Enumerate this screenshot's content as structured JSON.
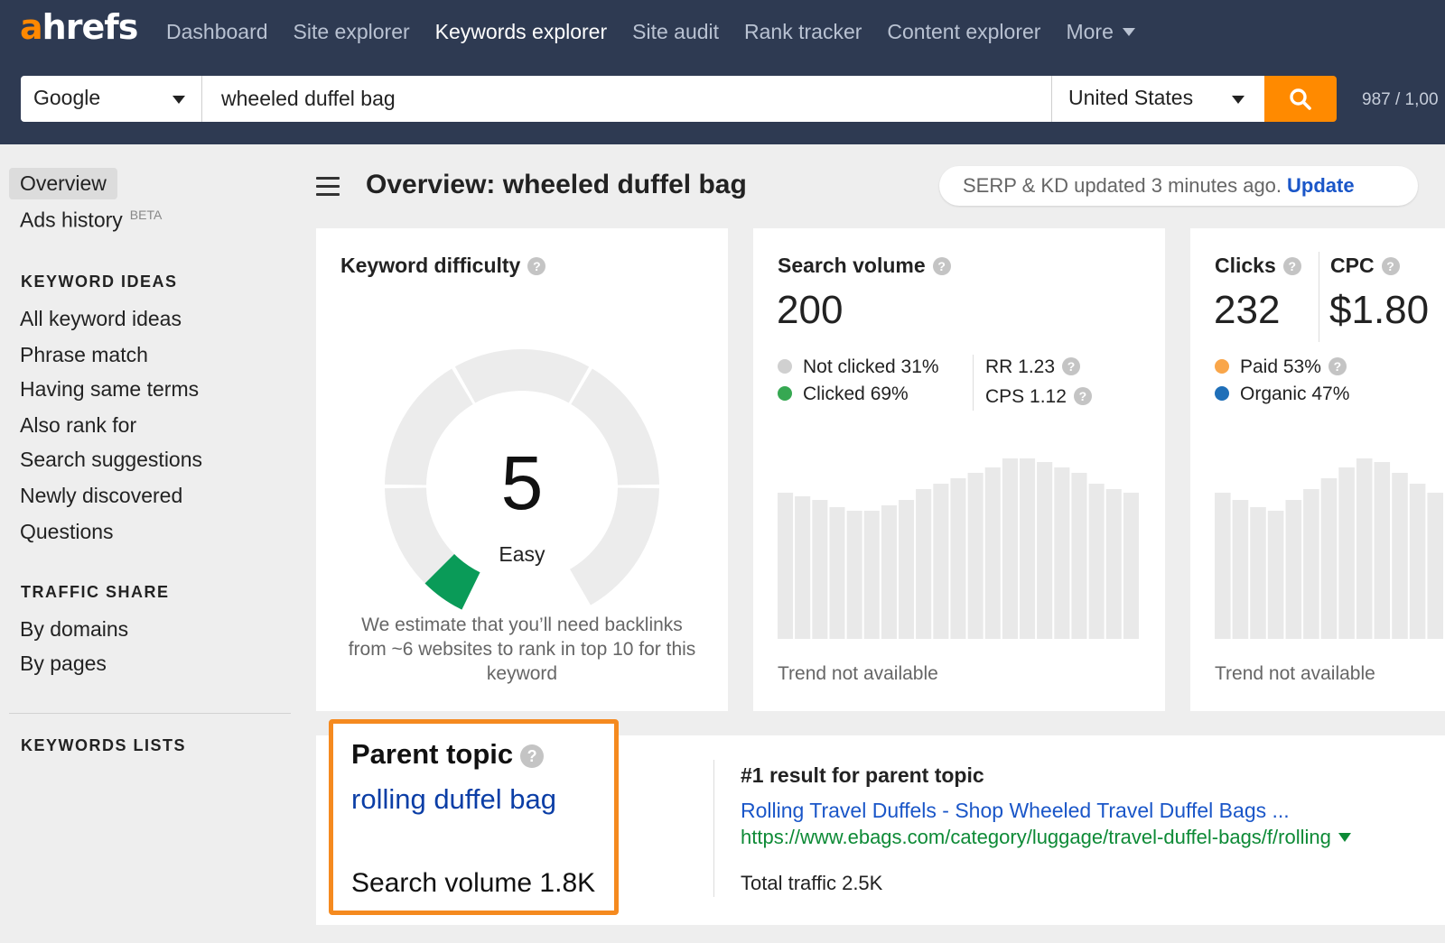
{
  "brand": {
    "logo_first": "a",
    "logo_rest": "hrefs",
    "accent": "#ff8800",
    "header_bg": "#2e3a52"
  },
  "nav": {
    "items": [
      {
        "label": "Dashboard",
        "active": false
      },
      {
        "label": "Site explorer",
        "active": false
      },
      {
        "label": "Keywords explorer",
        "active": true
      },
      {
        "label": "Site audit",
        "active": false
      },
      {
        "label": "Rank tracker",
        "active": false
      },
      {
        "label": "Content explorer",
        "active": false
      }
    ],
    "more_label": "More"
  },
  "search": {
    "engine": "Google",
    "query": "wheeled duffel bag",
    "country": "United States",
    "button_icon": "search-icon",
    "credits": "987 / 1,00"
  },
  "sidebar": {
    "overview": "Overview",
    "ads_history": "Ads history",
    "beta": "BETA",
    "keyword_ideas_heading": "KEYWORD IDEAS",
    "keyword_ideas": [
      "All keyword ideas",
      "Phrase match",
      "Having same terms",
      "Also rank for",
      "Search suggestions",
      "Newly discovered",
      "Questions"
    ],
    "traffic_share_heading": "TRAFFIC SHARE",
    "traffic_share": [
      "By domains",
      "By pages"
    ],
    "keywords_lists_heading": "KEYWORDS LISTS"
  },
  "header": {
    "title": "Overview: wheeled duffel bag",
    "update_text": "SERP & KD updated 3 minutes ago.",
    "update_link": "Update"
  },
  "kd": {
    "title": "Keyword difficulty",
    "value": "5",
    "value_num": 5,
    "label": "Easy",
    "note": "We estimate that you’ll need backlinks from ~6 websites to rank in top 10 for this keyword",
    "gauge_color": "#0a9b58"
  },
  "volume": {
    "title": "Search volume",
    "value": "200",
    "not_clicked": "Not clicked 31%",
    "clicked": "Clicked 69%",
    "rr": "RR 1.23",
    "cps": "CPS 1.12",
    "trend_note": "Trend not available",
    "colors": {
      "not_clicked": "#d0d0d0",
      "clicked": "#36a852"
    }
  },
  "clicks": {
    "title": "Clicks",
    "value": "232",
    "cpc_title": "CPC",
    "cpc_value": "$1.80",
    "paid": "Paid 53%",
    "organic": "Organic 47%",
    "trend_note": "Trend not available",
    "colors": {
      "paid": "#f9a64a",
      "organic": "#1f6fb8"
    }
  },
  "parent_topic": {
    "title": "Parent topic",
    "keyword": "rolling duffel bag",
    "volume": "Search volume 1.8K",
    "highlight_color": "#f58a1f"
  },
  "top_result": {
    "heading": "#1 result for parent topic",
    "title": "Rolling Travel Duffels - Shop Wheeled Travel Duffel Bags ...",
    "url": "https://www.ebags.com/category/luggage/travel-duffel-bags/f/rolling",
    "traffic": "Total traffic 2.5K"
  }
}
